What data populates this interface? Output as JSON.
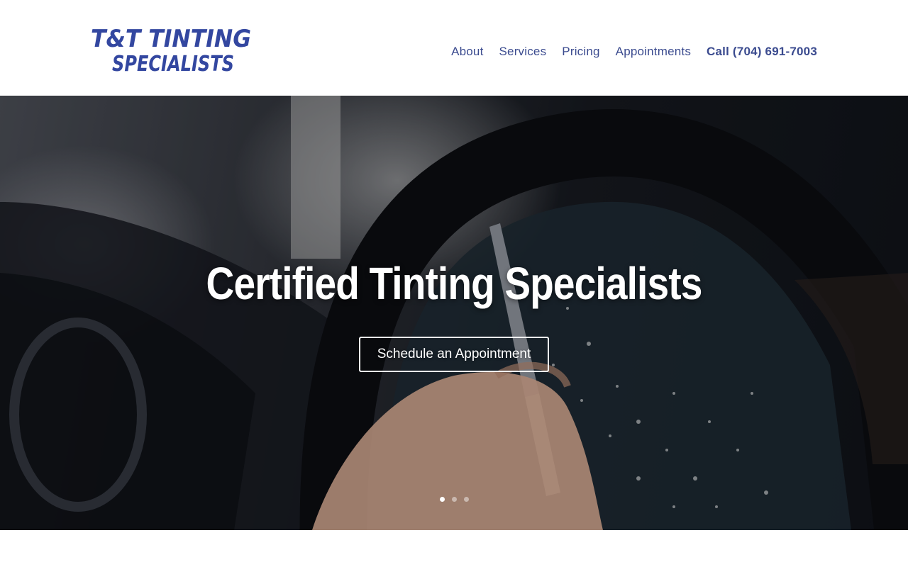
{
  "header": {
    "logo": {
      "line1": "T&T TINTING",
      "line2": "SPECIALISTS",
      "color": "#3347a0"
    },
    "nav": [
      {
        "label": "About"
      },
      {
        "label": "Services"
      },
      {
        "label": "Pricing"
      },
      {
        "label": "Appointments"
      },
      {
        "label": "Call (704) 691-7003"
      }
    ]
  },
  "hero": {
    "title": "Certified Tinting Specialists",
    "cta_label": "Schedule an Appointment",
    "image_subject": "hand applying window tint with squeegee on car window",
    "slider": {
      "slides": 3,
      "active": 1
    }
  },
  "colors": {
    "nav_text": "#3b4b8f",
    "brand": "#3347a0",
    "hero_text": "#ffffff"
  }
}
